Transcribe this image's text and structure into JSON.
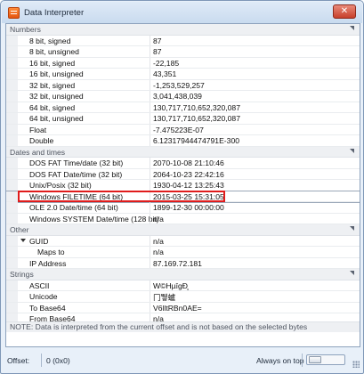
{
  "window": {
    "title": "Data Interpreter",
    "close_glyph": "✕"
  },
  "groups": [
    {
      "label": "Numbers",
      "rows": [
        {
          "name": "8 bit, signed",
          "value": "87"
        },
        {
          "name": "8 bit, unsigned",
          "value": "87"
        },
        {
          "name": "16 bit, signed",
          "value": "-22,185"
        },
        {
          "name": "16 bit, unsigned",
          "value": "43,351"
        },
        {
          "name": "32 bit, signed",
          "value": "-1,253,529,257"
        },
        {
          "name": "32 bit, unsigned",
          "value": "3,041,438,039"
        },
        {
          "name": "64 bit, signed",
          "value": "130,717,710,652,320,087"
        },
        {
          "name": "64 bit, unsigned",
          "value": "130,717,710,652,320,087"
        },
        {
          "name": "Float",
          "value": "-7.475223E-07"
        },
        {
          "name": "Double",
          "value": "6.12317944474791E-300"
        }
      ]
    },
    {
      "label": "Dates and times",
      "rows": [
        {
          "name": "DOS FAT Time/date (32 bit)",
          "value": "2070-10-08 21:10:46"
        },
        {
          "name": "DOS FAT Date/time (32 bit)",
          "value": "2064-10-23 22:42:16"
        },
        {
          "name": "Unix/Posix (32 bit)",
          "value": "1930-04-12 13:25:43"
        },
        {
          "name": "Windows FILETIME (64 bit)",
          "value": "2015-03-25 15:31:05",
          "selected": true
        },
        {
          "name": "OLE 2.0 Date/time (64 bit)",
          "value": "1899-12-30 00:00:00"
        },
        {
          "name": "Windows SYSTEM Date/time (128 bit)",
          "value": "n/a"
        }
      ]
    },
    {
      "label": "Other",
      "rows": [
        {
          "name": "GUID",
          "value": "n/a",
          "expandable": true
        },
        {
          "name": "Maps to",
          "value": "n/a",
          "indent": true
        },
        {
          "name": "IP Address",
          "value": "87.169.72.181"
        }
      ]
    },
    {
      "label": "Strings",
      "rows": [
        {
          "name": "ASCII",
          "value": "W©HµîgÐ̧"
        },
        {
          "name": "Unicode",
          "value": "冂뛯蠦"
        },
        {
          "name": "To Base64",
          "value": "V6lltRBn0AE="
        },
        {
          "name": "From Base64",
          "value": "n/a"
        }
      ]
    }
  ],
  "note": "NOTE: Data is interpreted from the current offset and is not based on the selected bytes",
  "status": {
    "offset_label": "Offset:",
    "offset_value": "0 (0x0)",
    "on_top_label": "Always on top"
  }
}
